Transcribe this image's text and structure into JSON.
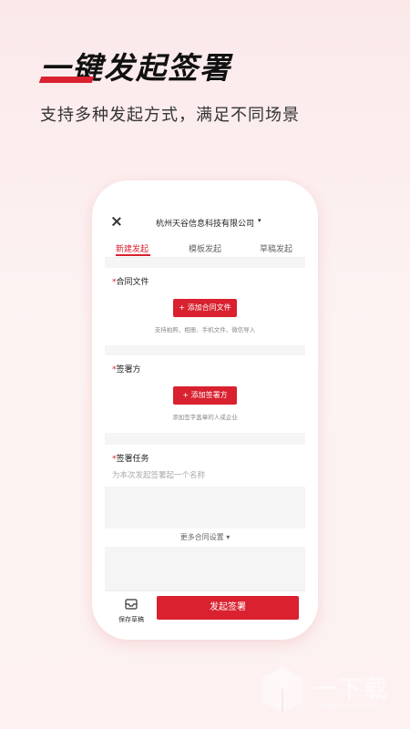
{
  "hero": {
    "title": "一键发起签署",
    "subtitle": "支持多种发起方式，满足不同场景"
  },
  "header": {
    "company": "杭州天谷信息科技有限公司",
    "caret": "▾"
  },
  "tabs": [
    {
      "label": "新建发起",
      "active": true
    },
    {
      "label": "模板发起",
      "active": false
    },
    {
      "label": "草稿发起",
      "active": false
    }
  ],
  "contract": {
    "required_mark": "*",
    "label": "合同文件",
    "button": "+ 添加合同文件",
    "hint": "支持拍照、相册、手机文件、微信导入"
  },
  "signer": {
    "required_mark": "*",
    "label": "签署方",
    "button": "+ 添加签署方",
    "hint": "添加签字盖章的人或企业"
  },
  "task": {
    "required_mark": "*",
    "label": "签署任务",
    "placeholder": "为本次发起签署起一个名称"
  },
  "more_settings": "更多合同设置 ▾",
  "bottom": {
    "save_draft": "保存草稿",
    "submit": "发起签署"
  },
  "watermark": {
    "text": "一下载",
    "url": "www.yxi4.com"
  },
  "colors": {
    "accent": "#d9212f",
    "background_top": "#fbe9ea"
  }
}
